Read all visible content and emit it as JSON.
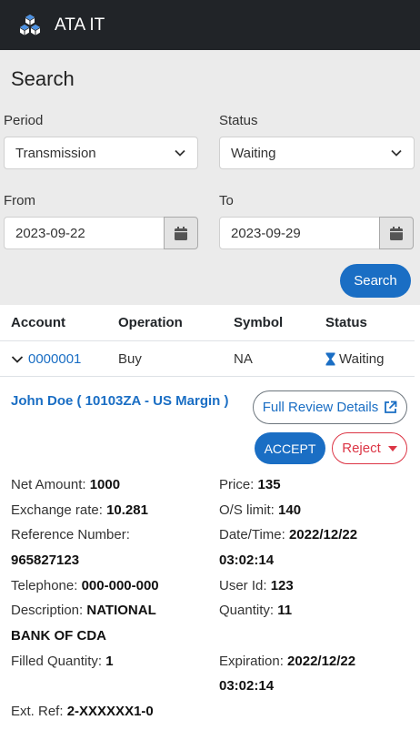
{
  "header": {
    "app_title": "ATA IT"
  },
  "search": {
    "title": "Search",
    "period_label": "Period",
    "period_value": "Transmission",
    "status_label": "Status",
    "status_value": "Waiting",
    "from_label": "From",
    "from_value": "2023-09-22",
    "to_label": "To",
    "to_value": "2023-09-29",
    "search_button": "Search"
  },
  "table": {
    "columns": [
      "Account",
      "Operation",
      "Symbol",
      "Status"
    ],
    "row": {
      "account": "0000001",
      "operation": "Buy",
      "symbol": "NA",
      "status": "Waiting"
    }
  },
  "detail": {
    "name": "John Doe ( 10103ZA - US Margin )",
    "full_review_label": "Full Review Details",
    "accept_label": "ACCEPT",
    "reject_label": "Reject",
    "fields": {
      "net_amount_label": "Net Amount:",
      "net_amount": "1000",
      "price_label": "Price:",
      "price": "135",
      "exchange_rate_label": "Exchange rate:",
      "exchange_rate": "10.281",
      "os_limit_label": "O/S limit:",
      "os_limit": "140",
      "reference_label": "Reference Number:",
      "reference": "965827123",
      "datetime_label": "Date/Time:",
      "datetime_date": "2022/12/22",
      "datetime_time": "03:02:14",
      "telephone_label": "Telephone:",
      "telephone": "000-000-000",
      "user_id_label": "User Id:",
      "user_id": "123",
      "description_label": "Description:",
      "description_line1": "NATIONAL",
      "description_line2": "BANK OF CDA",
      "quantity_label": "Quantity:",
      "quantity": "11",
      "filled_label": "Filled Quantity:",
      "filled": "1",
      "expiration_label": "Expiration:",
      "expiration_date": "2022/12/22",
      "expiration_time": "03:02:14",
      "ext_ref_label": "Ext. Ref:",
      "ext_ref": "2-XXXXXX1-0"
    }
  },
  "colors": {
    "primary": "#1a6ec4",
    "danger": "#dc3545",
    "topbar": "#212428",
    "panel": "#ebebeb"
  },
  "icons": {
    "logo": "cubes-icon",
    "chevron": "chevron-down-icon",
    "calendar": "calendar-icon",
    "hourglass": "hourglass-icon",
    "external": "external-link-icon",
    "caret": "caret-down-icon"
  }
}
